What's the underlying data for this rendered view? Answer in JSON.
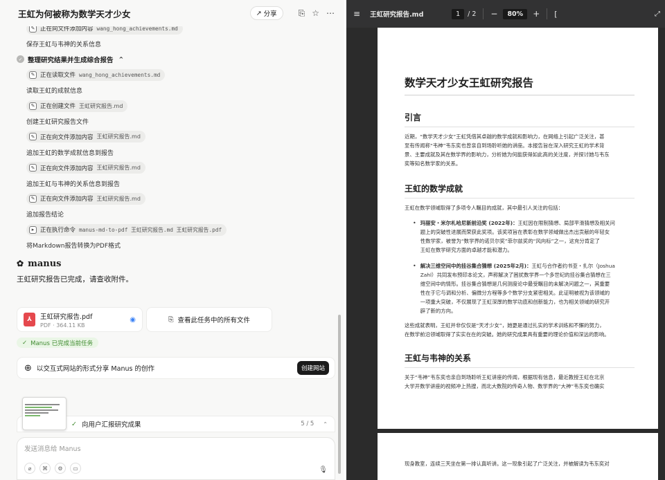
{
  "chat": {
    "title": "王虹为何被称为数学天才少女",
    "share_label": "分享",
    "items": [
      {
        "kind": "chip",
        "label": "正在向文件添加内容",
        "file": "wang_hong_achievements.md",
        "mono": true
      },
      {
        "kind": "step",
        "text": "保存王虹与韦神的关系信息"
      },
      {
        "kind": "section",
        "text": "整理研究结果并生成综合报告",
        "chevron": "^"
      },
      {
        "kind": "chip",
        "label": "正在读取文件",
        "file": "wang_hong_achievements.md",
        "mono": true
      },
      {
        "kind": "step",
        "text": "读取王虹的成就信息"
      },
      {
        "kind": "chip",
        "label": "正在创建文件",
        "file": "王虹研究报告.md",
        "mono": false
      },
      {
        "kind": "step",
        "text": "创建王虹研究报告文件"
      },
      {
        "kind": "chip",
        "label": "正在向文件添加内容",
        "file": "王虹研究报告.md",
        "mono": false
      },
      {
        "kind": "step",
        "text": "追加王虹的数学成就信息到报告"
      },
      {
        "kind": "chip",
        "label": "正在向文件添加内容",
        "file": "王虹研究报告.md",
        "mono": false
      },
      {
        "kind": "step",
        "text": "追加王虹与韦神的关系信息到报告"
      },
      {
        "kind": "chip",
        "label": "正在向文件添加内容",
        "file": "王虹研究报告.md",
        "mono": false
      },
      {
        "kind": "step",
        "text": "追加报告结论"
      },
      {
        "kind": "chip",
        "label": "正在执行命令",
        "file": "manus-md-to-pdf 王虹研究报告.md 王虹研究报告.pdf",
        "mono": true,
        "terminal": true
      },
      {
        "kind": "step",
        "text": "将Markdown报告转换为PDF格式"
      }
    ],
    "brand": "manus",
    "completion_msg": "王虹研究报告已完成，请查收附件。",
    "file_name": "王虹研究报告.pdf",
    "file_meta": "PDF · 364.11 KB",
    "view_all_label": "查看此任务中的所有文件",
    "complete_badge": "Manus 已完成当前任务",
    "share_prompt": "以交互式网站的形式分享 Manus 的创作",
    "build_button": "创建网站",
    "task_label": "向用户汇报研究成果",
    "task_progress": "5 / 5",
    "input_placeholder": "发送消息给 Manus"
  },
  "viewer": {
    "filename": "王虹研究报告.md",
    "page_current": "1",
    "page_total": "/ 2",
    "zoom": "80%"
  },
  "doc": {
    "title": "数学天才少女王虹研究报告",
    "s1_heading": "引言",
    "s1_lines": [
      "近期，“数学天才少女”王虹凭借其卓越的数学成就和影响力，在网络上引起广泛关注，甚",
      "至有传闻称“韦神”韦东奕也曾亲自到场聆听她的讲座。本报告旨在深入研究王虹的学术背",
      "景、主要成就及其在数学界的影响力，分析她为何能获得如此高的关注度，并探讨她与韦东",
      "奕等知名数学家的关系。"
    ],
    "s2_heading": "王虹的数学成就",
    "s2_intro": "王虹在数学领域取得了多项令人瞩目的成就，其中最引人关注的包括：",
    "b1_lines": [
      "玛丽安・米尔札哈尼新前沿奖 (2022年)：王虹因在限制猜想、局部平滑猜想及相关问",
      "题上的突破性进展而荣获此奖项。该奖项旨在表彰在数学领域做出杰出贡献的年轻女",
      "性数学家，被誉为“数学界的诺贝尔奖”菲尔兹奖的“风向标”之一，这充分肯定了",
      "王虹在数学研究方面的卓越才能和潜力。"
    ],
    "b2_lines": [
      "解决三维空间中的挂谷集合猜想 (2025年2月)：王虹与合作者约书亚・扎尔（Joshua",
      "Zahl）共同发布预印本论文，声称解决了困扰数学界一个多世纪的挂谷集合猜想在三",
      "维空间中的情形。挂谷集合猜想是几何测度论中最受瞩目的未解决问题之一，其重要",
      "性在于它与调和分析、偏微分方程等多个数学分支紧密相关。此证明被视为该领域的",
      "一项重大突破，不仅展现了王虹深厚的数学功底和创新能力，也为相关领域的研究开",
      "辟了新的方向。"
    ],
    "s2_summary": [
      "这些成就表明，王虹并非仅仅是“天才少女”，她更是通过扎实的学术训练和不懈的努力，",
      "在数学前沿领域取得了实实在在的突破。她的研究成果具有重要的理论价值和深远的影响。"
    ],
    "s3_heading": "王虹与韦神的关系",
    "s3_lines": [
      "关于“韦神”韦东奕也亲自到场聆听王虹讲座的传闻，根据现有信息，最近教授王虹在北京",
      "大学开数学讲座的视频冲上热搜，而北大数院的传奇人物、数学界的“大神”韦东奕也确实"
    ],
    "page2_line": "现身教室，连续三天坐在第一排认真听讲。这一现象引起了广泛关注，并被解读为韦东奕对"
  }
}
